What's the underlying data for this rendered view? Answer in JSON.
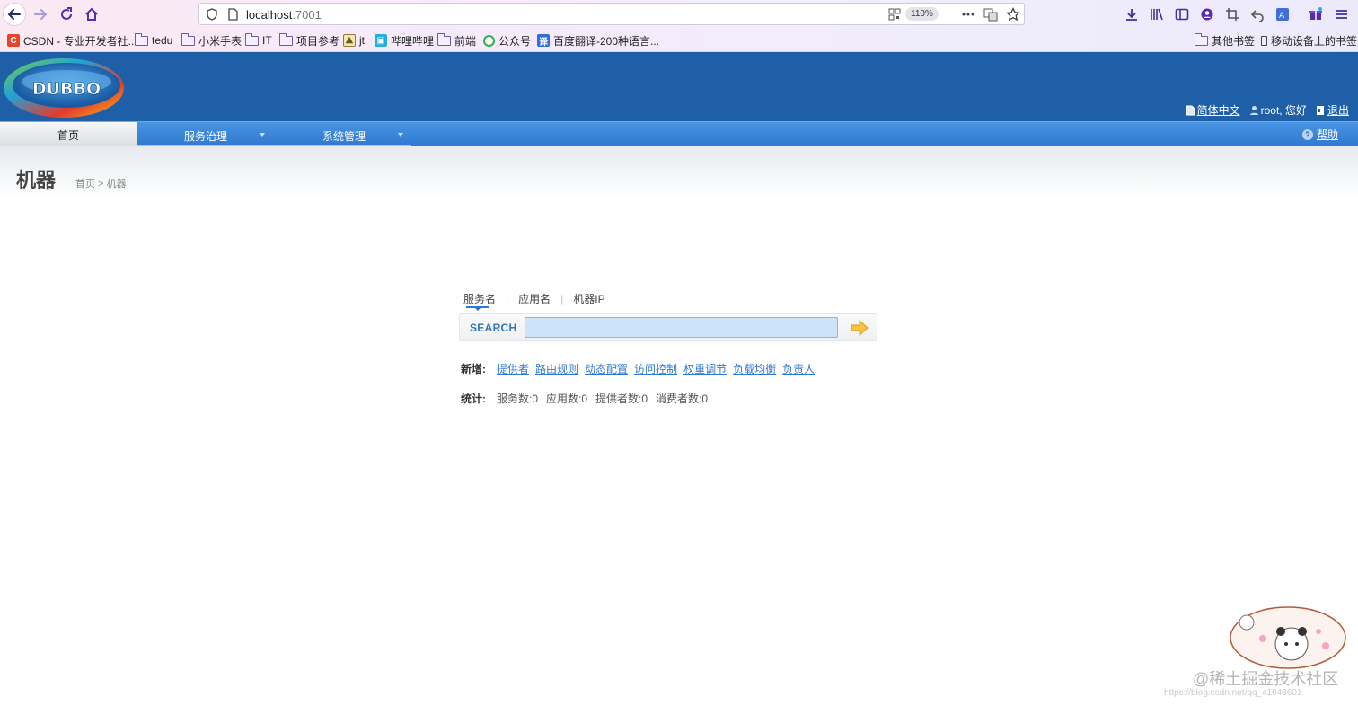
{
  "browser": {
    "url_host": "localhost",
    "url_port": ":7001",
    "zoom": "110%"
  },
  "bookmarks": [
    {
      "label": "CSDN - 专业开发者社...",
      "icon": "csdn-favicon"
    },
    {
      "label": "tedu",
      "icon": "folder-icon"
    },
    {
      "label": "小米手表",
      "icon": "folder-icon"
    },
    {
      "label": "IT",
      "icon": "folder-icon"
    },
    {
      "label": "项目参考",
      "icon": "folder-icon"
    },
    {
      "label": "jt",
      "icon": "image-favicon"
    },
    {
      "label": "哔哩哔哩",
      "icon": "bilibili-favicon"
    },
    {
      "label": "前端",
      "icon": "folder-icon"
    },
    {
      "label": "公众号",
      "icon": "wechat-favicon"
    },
    {
      "label": "百度翻译-200种语言...",
      "icon": "baidu-translate-favicon"
    }
  ],
  "bookmarks_right": {
    "other": "其他书签",
    "mobile": "移动设备上的书签"
  },
  "header": {
    "logo_text": "DUBBO",
    "language": "简体中文",
    "greeting": "root, 您好",
    "logout": "退出"
  },
  "nav": {
    "home": "首页",
    "service_gov": "服务治理",
    "system_mgmt": "系统管理",
    "help": "帮助"
  },
  "page": {
    "title": "机器",
    "breadcrumb": "首页 > 机器"
  },
  "search": {
    "tabs": [
      "服务名",
      "应用名",
      "机器IP"
    ],
    "active_tab": "服务名",
    "label": "SEARCH",
    "value": ""
  },
  "add_row": {
    "label": "新增:",
    "links": [
      "提供者",
      "路由规则",
      "动态配置",
      "访问控制",
      "权重调节",
      "负载均衡",
      "负责人"
    ]
  },
  "stats_row": {
    "label": "统计:",
    "items": [
      "服务数:0",
      "应用数:0",
      "提供者数:0",
      "消费者数:0"
    ]
  },
  "watermark": {
    "site": "@稀土掘金技术社区",
    "url": "https://blog.csdn.net/qq_41043601"
  }
}
